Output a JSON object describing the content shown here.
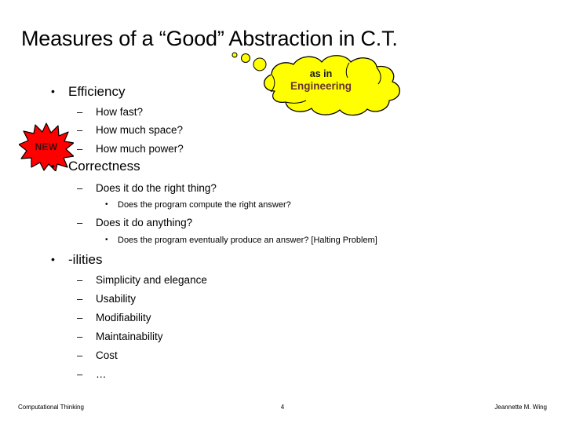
{
  "slide": {
    "title": "Measures of a “Good” Abstraction in C.T.",
    "page_number": "4"
  },
  "thought_cloud": {
    "line1": "as in",
    "line2": "Engineering",
    "fill_color": "#FFFF00",
    "stroke_color": "#000000"
  },
  "starburst": {
    "label": "NEW",
    "fill_color": "#FF0000",
    "stroke_color": "#000000"
  },
  "outline": {
    "efficiency": {
      "label": "Efficiency",
      "bullet": "•",
      "items": [
        {
          "mark": "–",
          "text": "How fast?"
        },
        {
          "mark": "–",
          "text": "How much space?"
        },
        {
          "mark": "–",
          "text": "How much power?"
        }
      ]
    },
    "correctness": {
      "label": "Correctness",
      "bullet": "•",
      "items": [
        {
          "mark": "–",
          "text": "Does it do the right thing?"
        },
        {
          "mark": "•",
          "text": "Does the program compute the right answer?"
        },
        {
          "mark": "–",
          "text": "Does it do anything?"
        },
        {
          "mark": "•",
          "text": "Does the program eventually produce an answer?  [Halting Problem]"
        }
      ]
    },
    "ilities": {
      "label": "-ilities",
      "bullet": "•",
      "items": [
        {
          "mark": "–",
          "text": "Simplicity and elegance"
        },
        {
          "mark": "–",
          "text": "Usability"
        },
        {
          "mark": "–",
          "text": "Modifiability"
        },
        {
          "mark": "–",
          "text": "Maintainability"
        },
        {
          "mark": "–",
          "text": "Cost"
        },
        {
          "mark": "–",
          "text": "…"
        }
      ]
    }
  },
  "footer": {
    "left": "Computational Thinking",
    "center": "4",
    "right": "Jeannette M. Wing"
  }
}
